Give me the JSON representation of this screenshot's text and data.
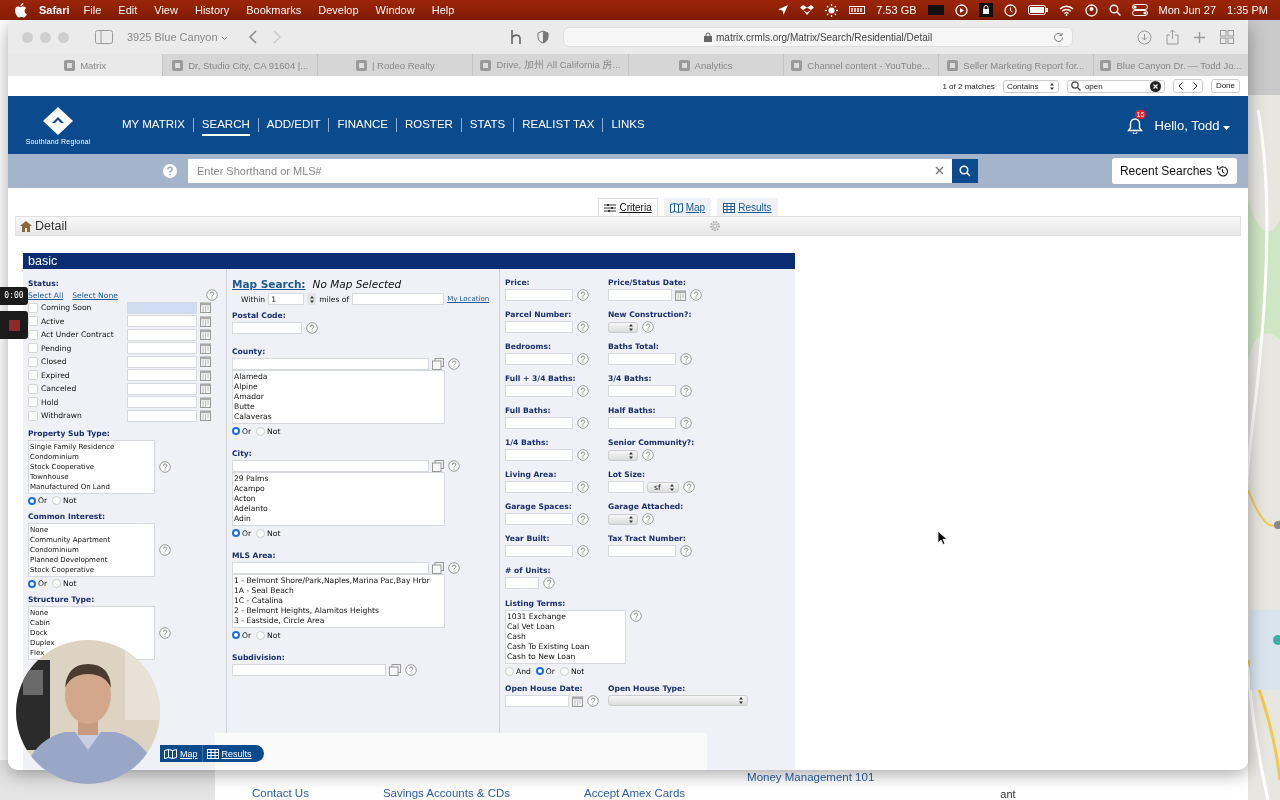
{
  "menu_bar": {
    "app": "Safari",
    "menus": [
      "File",
      "Edit",
      "View",
      "History",
      "Bookmarks",
      "Develop",
      "Window",
      "Help"
    ],
    "memory": "7.53 GB",
    "date": "Mon Jun 27",
    "time": "1:35 PM"
  },
  "browser": {
    "tab_group": "3925 Blue Canyon",
    "url": "matrix.crmls.org/Matrix/Search/Residential/Detail",
    "tabs": [
      {
        "title": "Matrix",
        "selected": true
      },
      {
        "title": "Dr, Studio City, CA 91604 |...",
        "selected": false
      },
      {
        "title": "| Rodeo Realty",
        "selected": false
      },
      {
        "title": "Drive, 加州 All California 房...",
        "selected": false
      },
      {
        "title": "Analytics",
        "selected": false
      },
      {
        "title": "Channel content - YouTube...",
        "selected": false
      },
      {
        "title": "Seller Marketing Report for...",
        "selected": false
      },
      {
        "title": "Blue Canyon Dr. — Todd Jo...",
        "selected": false
      }
    ],
    "find_bar": {
      "matches": "1 of 2 matches",
      "mode": "Contains",
      "query": "open",
      "done": "Done"
    }
  },
  "site": {
    "logo": "Southland Regional",
    "nav": [
      {
        "label": "MY MATRIX",
        "selected": false
      },
      {
        "label": "SEARCH",
        "selected": true
      },
      {
        "label": "ADD/EDIT",
        "selected": false
      },
      {
        "label": "FINANCE",
        "selected": false
      },
      {
        "label": "ROSTER",
        "selected": false
      },
      {
        "label": "STATS",
        "selected": false
      },
      {
        "label": "REALIST TAX",
        "selected": false
      },
      {
        "label": "LINKS",
        "selected": false
      }
    ],
    "notifications": "15",
    "greeting": "Hello, Todd",
    "search_placeholder": "Enter Shorthand or MLS#",
    "recent_searches": "Recent Searches"
  },
  "view_tabs": [
    {
      "label": "Criteria",
      "kind": "criteria",
      "selected": true
    },
    {
      "label": "Map",
      "kind": "map",
      "selected": false
    },
    {
      "label": "Results",
      "kind": "results",
      "selected": false
    }
  ],
  "detail_title": "Detail",
  "form": {
    "section": "basic",
    "status": {
      "label": "Status:",
      "select_all": "Select All",
      "select_none": "Select None",
      "items": [
        {
          "label": "Coming Soon",
          "checked": false,
          "focused": true
        },
        {
          "label": "Active",
          "checked": false,
          "focused": false
        },
        {
          "label": "Act Under Contract",
          "checked": false,
          "focused": false
        },
        {
          "label": "Pending",
          "checked": false,
          "focused": false
        },
        {
          "label": "Closed",
          "checked": false,
          "focused": false
        },
        {
          "label": "Expired",
          "checked": false,
          "focused": false
        },
        {
          "label": "Canceled",
          "checked": false,
          "focused": false
        },
        {
          "label": "Hold",
          "checked": false,
          "focused": false
        },
        {
          "label": "Withdrawn",
          "checked": false,
          "focused": false
        }
      ]
    },
    "left_lists": [
      {
        "label": "Property Sub Type:",
        "options": [
          "Single Family Residence",
          "Condominium",
          "Stock Cooperative",
          "Townhouse",
          "Manufactured On Land"
        ],
        "modes": [
          {
            "label": "Or",
            "selected": true
          },
          {
            "label": "Not",
            "selected": false
          }
        ]
      },
      {
        "label": "Common Interest:",
        "options": [
          "None",
          "Community Apartment",
          "Condominium",
          "Planned Development",
          "Stock Cooperative"
        ],
        "modes": [
          {
            "label": "Or",
            "selected": true
          },
          {
            "label": "Not",
            "selected": false
          }
        ]
      },
      {
        "label": "Structure Type:",
        "options": [
          "None",
          "Cabin",
          "Dock",
          "Duplex",
          "Flex"
        ]
      }
    ],
    "map_search": {
      "label": "Map Search:",
      "value": "No Map Selected",
      "within": "Within",
      "radius": "1",
      "miles_of": "miles of",
      "my_location": "My Location"
    },
    "postal_code": {
      "label": "Postal Code:"
    },
    "lookups": [
      {
        "label": "County:",
        "options": [
          "Alameda",
          "Alpine",
          "Amador",
          "Butte",
          "Calaveras"
        ],
        "modes": [
          {
            "label": "Or",
            "selected": true
          },
          {
            "label": "Not",
            "selected": false
          }
        ]
      },
      {
        "label": "City:",
        "options": [
          "29 Palms",
          "Acampo",
          "Acton",
          "Adelanto",
          "Adin"
        ],
        "modes": [
          {
            "label": "Or",
            "selected": true
          },
          {
            "label": "Not",
            "selected": false
          }
        ]
      },
      {
        "label": "MLS Area:",
        "options": [
          "1 - Belmont Shore/Park,Naples,Marina Pac,Bay Hrbr",
          "1A - Seal Beach",
          "1C - Catalina",
          "2 - Belmont Heights, Alamitos Heights",
          "3 - Eastside, Circle Area"
        ],
        "modes": [
          {
            "label": "Or",
            "selected": true
          },
          {
            "label": "Not",
            "selected": false
          }
        ]
      },
      {
        "label": "Subdivision:"
      }
    ],
    "fields": [
      {
        "label": "Price:",
        "kind": "text"
      },
      {
        "label": "Price/Status Date:",
        "kind": "date"
      },
      {
        "label": "Parcel Number:",
        "kind": "text"
      },
      {
        "label": "New Construction?:",
        "kind": "select"
      },
      {
        "label": "Bedrooms:",
        "kind": "text"
      },
      {
        "label": "Baths Total:",
        "kind": "text"
      },
      {
        "label": "Full + 3/4 Baths:",
        "kind": "text"
      },
      {
        "label": "3/4 Baths:",
        "kind": "text"
      },
      {
        "label": "Full Baths:",
        "kind": "text"
      },
      {
        "label": "Half Baths:",
        "kind": "text"
      },
      {
        "label": "1/4 Baths:",
        "kind": "text"
      },
      {
        "label": "Senior Community?:",
        "kind": "select"
      },
      {
        "label": "Living Area:",
        "kind": "text"
      },
      {
        "label": "Lot Size:",
        "kind": "lot",
        "unit": "sf"
      },
      {
        "label": "Garage Spaces:",
        "kind": "text"
      },
      {
        "label": "Garage Attached:",
        "kind": "select"
      },
      {
        "label": "Year Built:",
        "kind": "text"
      },
      {
        "label": "Tax Tract Number:",
        "kind": "text"
      },
      {
        "label": "# of Units:",
        "kind": "short"
      }
    ],
    "listing_terms": {
      "label": "Listing Terms:",
      "options": [
        "1031 Exchange",
        "Cal Vet Loan",
        "Cash",
        "Cash To Existing Loan",
        "Cash to New Loan"
      ],
      "modes": [
        {
          "label": "And",
          "selected": false
        },
        {
          "label": "Or",
          "selected": true
        },
        {
          "label": "Not",
          "selected": false
        }
      ]
    },
    "open_house": [
      {
        "label": "Open House Date:",
        "kind": "date"
      },
      {
        "label": "Open House Type:",
        "kind": "wide_select"
      }
    ]
  },
  "bottom_bar": [
    {
      "label": "Map",
      "kind": "map"
    },
    {
      "label": "Results",
      "kind": "results"
    }
  ],
  "recorder": {
    "time": "0:00"
  },
  "background_page": {
    "links": [
      "Contact Us",
      "Savings Accounts & CDs",
      "Accept Amex Cards",
      "Money Management 101"
    ],
    "fragment": "ant"
  }
}
